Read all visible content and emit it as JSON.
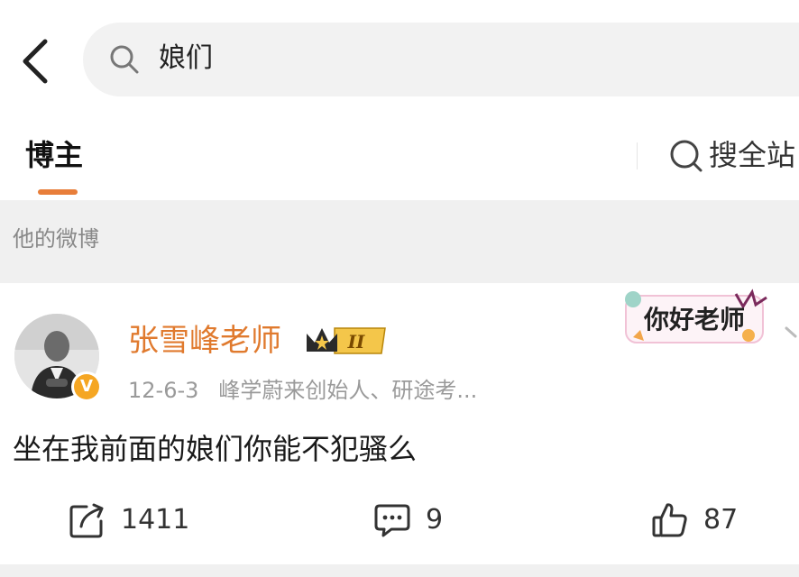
{
  "search": {
    "query": "娘们"
  },
  "tabs": {
    "active": "博主",
    "search_all": "搜全站"
  },
  "section": {
    "title": "他的微博"
  },
  "post": {
    "author": "张雪峰老师",
    "level_badge": "II",
    "verified_mark": "V",
    "date": "12-6-3",
    "bio": "峰学蔚来创始人、研途考...",
    "sticker_text": "你好老师",
    "text": "坐在我前面的娘们你能不犯骚么",
    "shares": "1411",
    "comments": "9",
    "likes": "87"
  },
  "colors": {
    "accent": "#e87e3a",
    "author_name": "#e07a2e",
    "verified": "#f5a623",
    "section_bg": "#f0f0f0",
    "search_bg": "#f2f2f2"
  },
  "icons": {
    "back": "chevron-left-icon",
    "search": "search-icon",
    "share": "share-icon",
    "comment": "comment-icon",
    "like": "thumbs-up-icon",
    "crown": "crown-icon"
  }
}
